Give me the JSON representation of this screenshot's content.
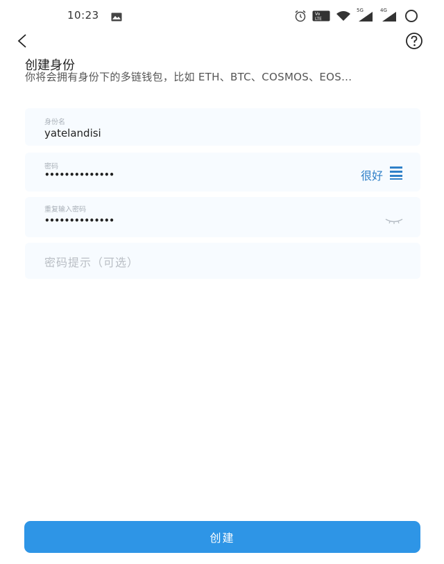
{
  "status_bar": {
    "time": "10:23",
    "signal_label_1": "5G",
    "signal_label_2": "4G",
    "icons": [
      "image-icon",
      "alarm-icon",
      "volte-icon",
      "wifi-icon",
      "signal-icon",
      "signal-icon",
      "battery-icon"
    ]
  },
  "nav": {
    "back_icon": "chevron-left-icon",
    "help_icon": "help-circle-icon"
  },
  "header": {
    "title": "创建身份",
    "subtitle": "你将会拥有身份下的多链钱包，比如 ETH、BTC、COSMOS、EOS..."
  },
  "form": {
    "identity_name": {
      "label": "身份名",
      "value": "yatelandisi"
    },
    "password": {
      "label": "密码",
      "value": "••••••••••••••",
      "strength": "很好",
      "strength_icon": "strength-bars-icon"
    },
    "confirm_password": {
      "label": "重复输入密码",
      "value": "••••••••••••••",
      "toggle_icon": "eye-closed-icon"
    },
    "password_hint": {
      "placeholder": "密码提示（可选）"
    }
  },
  "actions": {
    "create_label": "创建"
  },
  "colors": {
    "accent": "#2e95e6",
    "strength": "#2f80c8",
    "field_bg": "#f7fbff"
  }
}
